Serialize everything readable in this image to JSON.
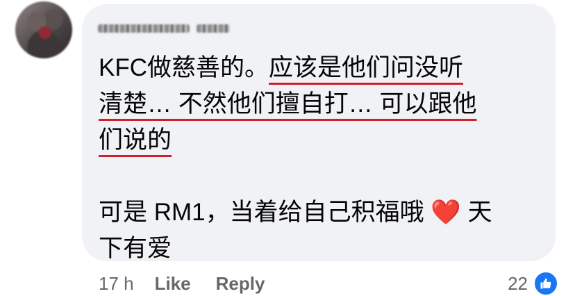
{
  "comment": {
    "author_redacted": true,
    "line1_plain": "KFC做慈善的。",
    "line1_highlight": "应该是他们问没听",
    "line2_highlight": "清楚… 不然他们擅自打… 可以跟他",
    "line3_highlight": "们说的",
    "line4": "可是 RM1，当着给自己积福哦",
    "heart_glyph": "❤️",
    "line4_tail": " 天",
    "line5": "下有爱",
    "highlight_color": "#d21f2b"
  },
  "footer": {
    "time": "17 h",
    "like_label": "Like",
    "reply_label": "Reply",
    "reaction_count": "22",
    "reaction_icon": "thumbs-up-icon"
  },
  "colors": {
    "bubble": "#f0f2f5",
    "meta_text": "#65676b",
    "like_blue": "#1877f2"
  }
}
